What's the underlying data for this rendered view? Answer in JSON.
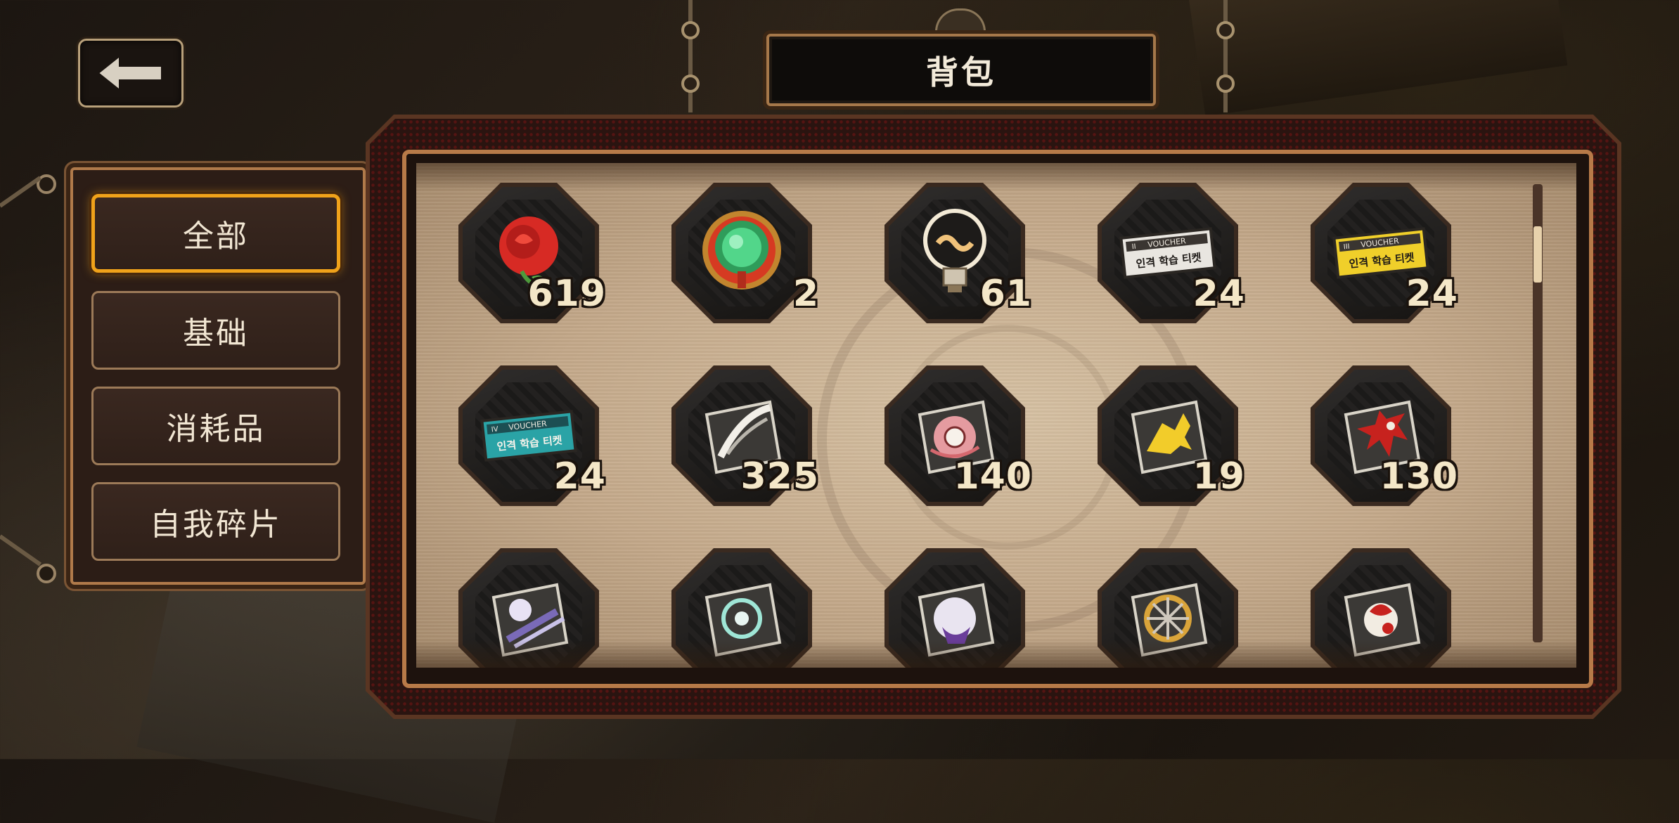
{
  "header": {
    "title": "背包",
    "back_icon": "back-arrow-icon"
  },
  "sidebar": {
    "items": [
      {
        "label": "全部",
        "active": true
      },
      {
        "label": "基础",
        "active": false
      },
      {
        "label": "消耗品",
        "active": false
      },
      {
        "label": "自我碎片",
        "active": false
      }
    ]
  },
  "inventory": {
    "items": [
      {
        "icon": "rose-icon",
        "count": "619"
      },
      {
        "icon": "green-gem-icon",
        "count": "2"
      },
      {
        "icon": "lightbulb-icon",
        "count": "61"
      },
      {
        "icon": "voucher-ticket-white-icon",
        "count": "24"
      },
      {
        "icon": "voucher-ticket-yellow-icon",
        "count": "24"
      },
      {
        "icon": "voucher-ticket-teal-icon",
        "count": "24"
      },
      {
        "icon": "white-feather-shard-icon",
        "count": "325"
      },
      {
        "icon": "pink-rose-shard-icon",
        "count": "140"
      },
      {
        "icon": "golden-horse-shard-icon",
        "count": "19"
      },
      {
        "icon": "red-ink-shard-icon",
        "count": "130"
      },
      {
        "icon": "sun-blade-shard-icon",
        "count": ""
      },
      {
        "icon": "eye-swirl-shard-icon",
        "count": ""
      },
      {
        "icon": "purple-moon-shard-icon",
        "count": ""
      },
      {
        "icon": "golden-wheel-shard-icon",
        "count": ""
      },
      {
        "icon": "red-flower-shard-icon",
        "count": ""
      }
    ],
    "voucher_text": "VOUCHER",
    "ticket_text": "인격 학습 티켓",
    "ticket_roman_2": "II",
    "ticket_roman_3": "III",
    "ticket_roman_4": "IV"
  },
  "colors": {
    "accent_active": "#f0a21a",
    "frame_copper": "#b77a48",
    "count_text": "#f4e7c8"
  }
}
